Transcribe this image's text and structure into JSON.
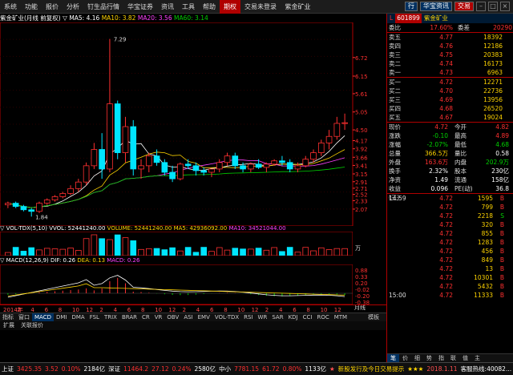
{
  "menu": {
    "items": [
      "系统",
      "功能",
      "报价",
      "分析",
      "钉生品行情",
      "华宝证券",
      "资讯",
      "工具",
      "帮助"
    ],
    "hot": "期权",
    "center": "交易未登录",
    "center_stock": "紫金矿业",
    "right": [
      "行",
      "华宝资讯",
      "交易"
    ]
  },
  "chart_head": {
    "name": "紫金矿业(月线 前复权)",
    "ma5": "MA5: 4.16",
    "ma10": "MA10: 3.82",
    "ma20": "MA20: 3.56",
    "ma60": "MA60: 3.14",
    "high_label": "7.29",
    "low_label": "1.84"
  },
  "price_axis": [
    "6.72",
    "6.15",
    "5.61",
    "5.05",
    "4.50",
    "4.17",
    "3.92",
    "3.66",
    "3.41",
    "3.15",
    "2.91",
    "2.71",
    "2.52",
    "2.33",
    "2.07"
  ],
  "vol_head": {
    "name": "VOL-TDX(5,10)",
    "vvol": "VVOL: 52441240.00",
    "volume": "VOLUME: 52441240.00",
    "ma5": "MA5: 42936092.00",
    "ma10": "MA10: 34521044.00",
    "unit": "万"
  },
  "macd_head": {
    "name": "MACD(12,26,9)",
    "dif": "DIF: 0.26",
    "dea": "DEA: 0.13",
    "macd": "MACD: 0.26"
  },
  "macd_axis": [
    "0.88",
    "0.33",
    "0.20",
    "-0.02",
    "-0.20",
    "-0.38"
  ],
  "date_axis": [
    "2014年",
    "2",
    "4",
    "6",
    "8",
    "10",
    "12",
    "2",
    "4",
    "6",
    "8",
    "10",
    "12",
    "2",
    "4",
    "6",
    "8",
    "10",
    "12",
    "2",
    "4",
    "6",
    "8",
    "10",
    "12"
  ],
  "date_axis_right": "月线",
  "tabs": [
    "指标",
    "窗口",
    "MACD",
    "DMI",
    "DMA",
    "FSL",
    "TRIX",
    "BRAR",
    "CR",
    "VR",
    "OBV",
    "ASI",
    "EMV",
    "VOL-TDX",
    "RSI",
    "WR",
    "SAR",
    "KDJ",
    "CCI",
    "ROC",
    "MTM"
  ],
  "tabs_active": "MACD",
  "tabs_more": "模板",
  "expand_bar": [
    "扩展",
    "关联报价"
  ],
  "right_panel": {
    "code": "601899",
    "name": "紫金矿业",
    "webi_label": "委比",
    "webi_val": "17.60%",
    "wecha_label": "委差",
    "wecha_val": "20290",
    "sells": [
      {
        "label": "卖五",
        "price": "4.77",
        "vol": "18392"
      },
      {
        "label": "卖四",
        "price": "4.76",
        "vol": "12186"
      },
      {
        "label": "卖三",
        "price": "4.75",
        "vol": "20383"
      },
      {
        "label": "卖二",
        "price": "4.74",
        "vol": "16173"
      },
      {
        "label": "卖一",
        "price": "4.73",
        "vol": "6963"
      }
    ],
    "buys": [
      {
        "label": "买一",
        "price": "4.72",
        "vol": "12271"
      },
      {
        "label": "买二",
        "price": "4.70",
        "vol": "22736"
      },
      {
        "label": "买三",
        "price": "4.69",
        "vol": "13956"
      },
      {
        "label": "买四",
        "price": "4.68",
        "vol": "26520"
      },
      {
        "label": "买五",
        "price": "4.67",
        "vol": "19024"
      }
    ],
    "quote": [
      {
        "k1": "现价",
        "v1": "4.72",
        "c1": "red",
        "k2": "今开",
        "v2": "4.82",
        "c2": "red"
      },
      {
        "k1": "涨跌",
        "v1": "-0.10",
        "c1": "grn",
        "k2": "最高",
        "v2": "4.89",
        "c2": "red"
      },
      {
        "k1": "涨幅",
        "v1": "-2.07%",
        "c1": "grn",
        "k2": "最低",
        "v2": "4.68",
        "c2": "grn"
      },
      {
        "k1": "总量",
        "v1": "366.5万",
        "c1": "yellow",
        "k2": "量比",
        "v2": "0.58",
        "c2": "white"
      },
      {
        "k1": "外盘",
        "v1": "163.6万",
        "c1": "red",
        "k2": "内盘",
        "v2": "202.9万",
        "c2": "grn"
      },
      {
        "k1": "换手",
        "v1": "2.32%",
        "c1": "white",
        "k2": "股本",
        "v2": "230亿",
        "c2": "white"
      },
      {
        "k1": "净资",
        "v1": "1.49",
        "c1": "white",
        "k2": "流通",
        "v2": "158亿",
        "c2": "white"
      },
      {
        "k1": "收益(三)",
        "v1": "0.096",
        "c1": "white",
        "k2": "PE(动)",
        "v2": "36.8",
        "c2": "white"
      }
    ],
    "ticks": [
      {
        "t": "14:59",
        "p": "4.72",
        "v": "1595",
        "f": "B"
      },
      {
        "t": "",
        "p": "4.72",
        "v": "799",
        "f": "B"
      },
      {
        "t": "",
        "p": "4.72",
        "v": "2218",
        "f": "S"
      },
      {
        "t": "",
        "p": "4.72",
        "v": "320",
        "f": "B"
      },
      {
        "t": "",
        "p": "4.72",
        "v": "855",
        "f": "B"
      },
      {
        "t": "",
        "p": "4.72",
        "v": "1283",
        "f": "B"
      },
      {
        "t": "",
        "p": "4.72",
        "v": "456",
        "f": "B"
      },
      {
        "t": "",
        "p": "4.72",
        "v": "849",
        "f": "B"
      },
      {
        "t": "",
        "p": "4.72",
        "v": "13",
        "f": "B"
      },
      {
        "t": "",
        "p": "4.72",
        "v": "10301",
        "f": "B"
      },
      {
        "t": "",
        "p": "4.72",
        "v": "5432",
        "f": "B"
      },
      {
        "t": "15:00",
        "p": "4.72",
        "v": "11333",
        "f": "B"
      }
    ],
    "tabs": [
      "笔",
      "价",
      "细",
      "势",
      "指",
      "联",
      "值",
      "主"
    ]
  },
  "status": {
    "sh_label": "上证",
    "sh_val": "3425.35",
    "sh_chg": "3.52",
    "sh_pct": "0.10%",
    "sh_amt": "2184亿",
    "sz_label": "深证",
    "sz_val": "11464.2",
    "sz_chg": "27.12",
    "sz_pct": "0.24%",
    "sz_amt": "2580亿",
    "zx_label": "中小",
    "zx_val": "7781.15",
    "zx_chg": "61.72",
    "zx_pct": "0.80%",
    "zx_amt": "1133亿",
    "ticker": "新股发行及今日交易提示",
    "date": "2018.1.11",
    "hotline": "客服热线:40082..."
  },
  "colors": {
    "up": "#ff3030",
    "down": "#00e5ff",
    "ma5": "#ffffff",
    "ma10": "#ffd400",
    "ma20": "#ff40ff",
    "ma60": "#00d000",
    "frame": "#b00000"
  }
}
